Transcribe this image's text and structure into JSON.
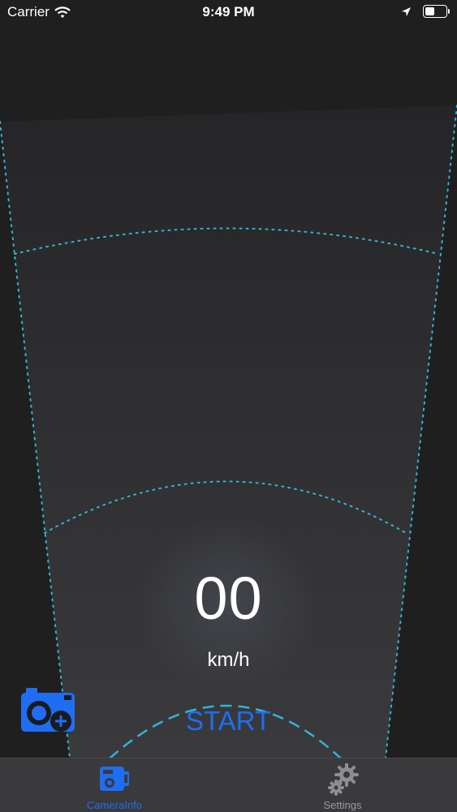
{
  "status_bar": {
    "carrier": "Carrier",
    "time": "9:49 PM",
    "battery_level": 0.45
  },
  "speedometer": {
    "speed": "00",
    "unit": "km/h"
  },
  "controls": {
    "start_label": "START"
  },
  "tab_bar": {
    "tabs": [
      {
        "label": "CameraInfo",
        "icon": "camera-icon",
        "active": true
      },
      {
        "label": "Settings",
        "icon": "gear-icon",
        "active": false
      }
    ]
  },
  "colors": {
    "accent": "#1f6df2",
    "dotted_lines": "#33b3d6",
    "background": "#1f1f20"
  }
}
